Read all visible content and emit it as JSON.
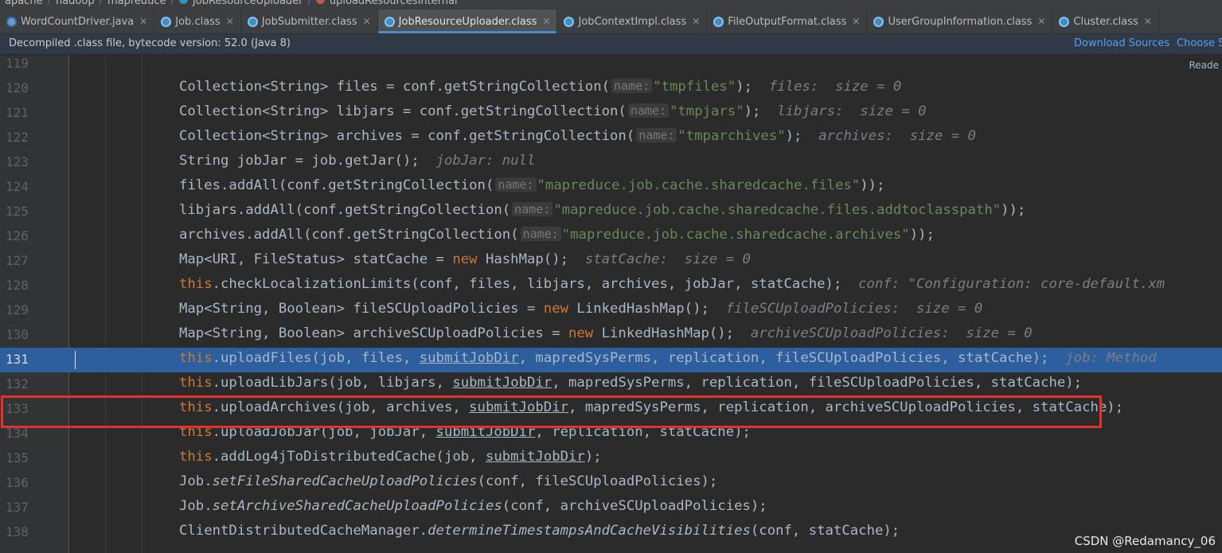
{
  "breadcrumb": [
    "apache",
    "hadoop",
    "mapreduce",
    "JobResourceUploader",
    "uploadResourcesInternal"
  ],
  "tabs": [
    {
      "label": "WordCountDriver.java",
      "icon": "java-file-icon",
      "active": false
    },
    {
      "label": "Job.class",
      "icon": "class-file-icon",
      "active": false
    },
    {
      "label": "JobSubmitter.class",
      "icon": "class-file-icon",
      "active": false
    },
    {
      "label": "JobResourceUploader.class",
      "icon": "class-file-icon",
      "active": true
    },
    {
      "label": "JobContextImpl.class",
      "icon": "class-file-icon",
      "active": false
    },
    {
      "label": "FileOutputFormat.class",
      "icon": "class-file-icon",
      "active": false
    },
    {
      "label": "UserGroupInformation.class",
      "icon": "class-file-icon",
      "active": false
    },
    {
      "label": "Cluster.class",
      "icon": "class-file-icon",
      "active": false
    }
  ],
  "banner": {
    "message": "Decompiled .class file, bytecode version: 52.0 (Java 8)",
    "download_sources": "Download Sources",
    "choose_sources": "Choose So"
  },
  "reader_mode": "Reade",
  "highlighted_line": "131",
  "code_lines": [
    {
      "num": "119"
    },
    {
      "num": "120",
      "code": "Collection<String> files = conf.getStringCollection(",
      "param": "name:",
      "str": "\"tmpfiles\"",
      "close": ");",
      "hint": "files:  size = 0"
    },
    {
      "num": "121",
      "code": "Collection<String> libjars = conf.getStringCollection(",
      "param": "name:",
      "str": "\"tmpjars\"",
      "close": ");",
      "hint": "libjars:  size = 0"
    },
    {
      "num": "122",
      "code": "Collection<String> archives = conf.getStringCollection(",
      "param": "name:",
      "str": "\"tmparchives\"",
      "close": ");",
      "hint": "archives:  size = 0"
    },
    {
      "num": "123",
      "code": "String jobJar = job.getJar();",
      "hint": "jobJar: null"
    },
    {
      "num": "124",
      "code": "files.addAll(conf.getStringCollection(",
      "param": "name:",
      "str": "\"mapreduce.job.cache.sharedcache.files\"",
      "close": "));"
    },
    {
      "num": "125",
      "code": "libjars.addAll(conf.getStringCollection(",
      "param": "name:",
      "str": "\"mapreduce.job.cache.sharedcache.files.addtoclasspath\"",
      "close": "));"
    },
    {
      "num": "126",
      "code": "archives.addAll(conf.getStringCollection(",
      "param": "name:",
      "str": "\"mapreduce.job.cache.sharedcache.archives\"",
      "close": "));"
    },
    {
      "num": "127",
      "code": "Map<URI, FileStatus> statCache = ",
      "kw": "new",
      "rest": " HashMap();",
      "hint": "statCache:  size = 0"
    },
    {
      "num": "128",
      "this": "this",
      "rest": ".checkLocalizationLimits(conf, files, libjars, archives, jobJar, statCache);",
      "hint": "conf: \"Configuration: core-default.xm"
    },
    {
      "num": "129",
      "code": "Map<String, Boolean> fileSCUploadPolicies = ",
      "kw": "new",
      "rest": " LinkedHashMap();",
      "hint": "fileSCUploadPolicies:  size = 0"
    },
    {
      "num": "130",
      "code": "Map<String, Boolean> archiveSCUploadPolicies = ",
      "kw": "new",
      "rest": " LinkedHashMap();",
      "hint": "archiveSCUploadPolicies:  size = 0"
    },
    {
      "num": "131",
      "this": "this",
      "pre": ".uploadFiles(job, files, ",
      "u": "submitJobDir",
      "post": ", mapredSysPerms, replication, fileSCUploadPolicies, statCache);",
      "hint": "job: Method"
    },
    {
      "num": "132",
      "this": "this",
      "pre": ".uploadLibJars(job, libjars, ",
      "u": "submitJobDir",
      "post": ", mapredSysPerms, replication, fileSCUploadPolicies, statCache);"
    },
    {
      "num": "133",
      "this": "this",
      "pre": ".uploadArchives(job, archives, ",
      "u": "submitJobDir",
      "post": ", mapredSysPerms, replication, archiveSCUploadPolicies, statCache);"
    },
    {
      "num": "134",
      "this": "this",
      "pre": ".uploadJobJar(job, jobJar, ",
      "u": "submitJobDir",
      "post": ", replication, statCache);"
    },
    {
      "num": "135",
      "this": "this",
      "pre": ".addLog4jToDistributedCache(job, ",
      "u": "submitJobDir",
      "post": ");"
    },
    {
      "num": "136",
      "code": "Job.",
      "italic": "setFileSharedCacheUploadPolicies",
      "rest": "(conf, fileSCUploadPolicies);"
    },
    {
      "num": "137",
      "code": "Job.",
      "italic": "setArchiveSharedCacheUploadPolicies",
      "rest": "(conf, archiveSCUploadPolicies);"
    },
    {
      "num": "138",
      "code": "ClientDistributedCacheManager.",
      "italic": "determineTimestampsAndCacheVisibilities",
      "rest": "(conf, statCache);"
    }
  ],
  "watermark": "CSDN @Redamancy_06",
  "colors": {
    "accent": "#4a88c7",
    "selection": "#2d5e9e",
    "highlight_box": "#e5312d",
    "keyword": "#cc7832",
    "string": "#6a8759"
  }
}
